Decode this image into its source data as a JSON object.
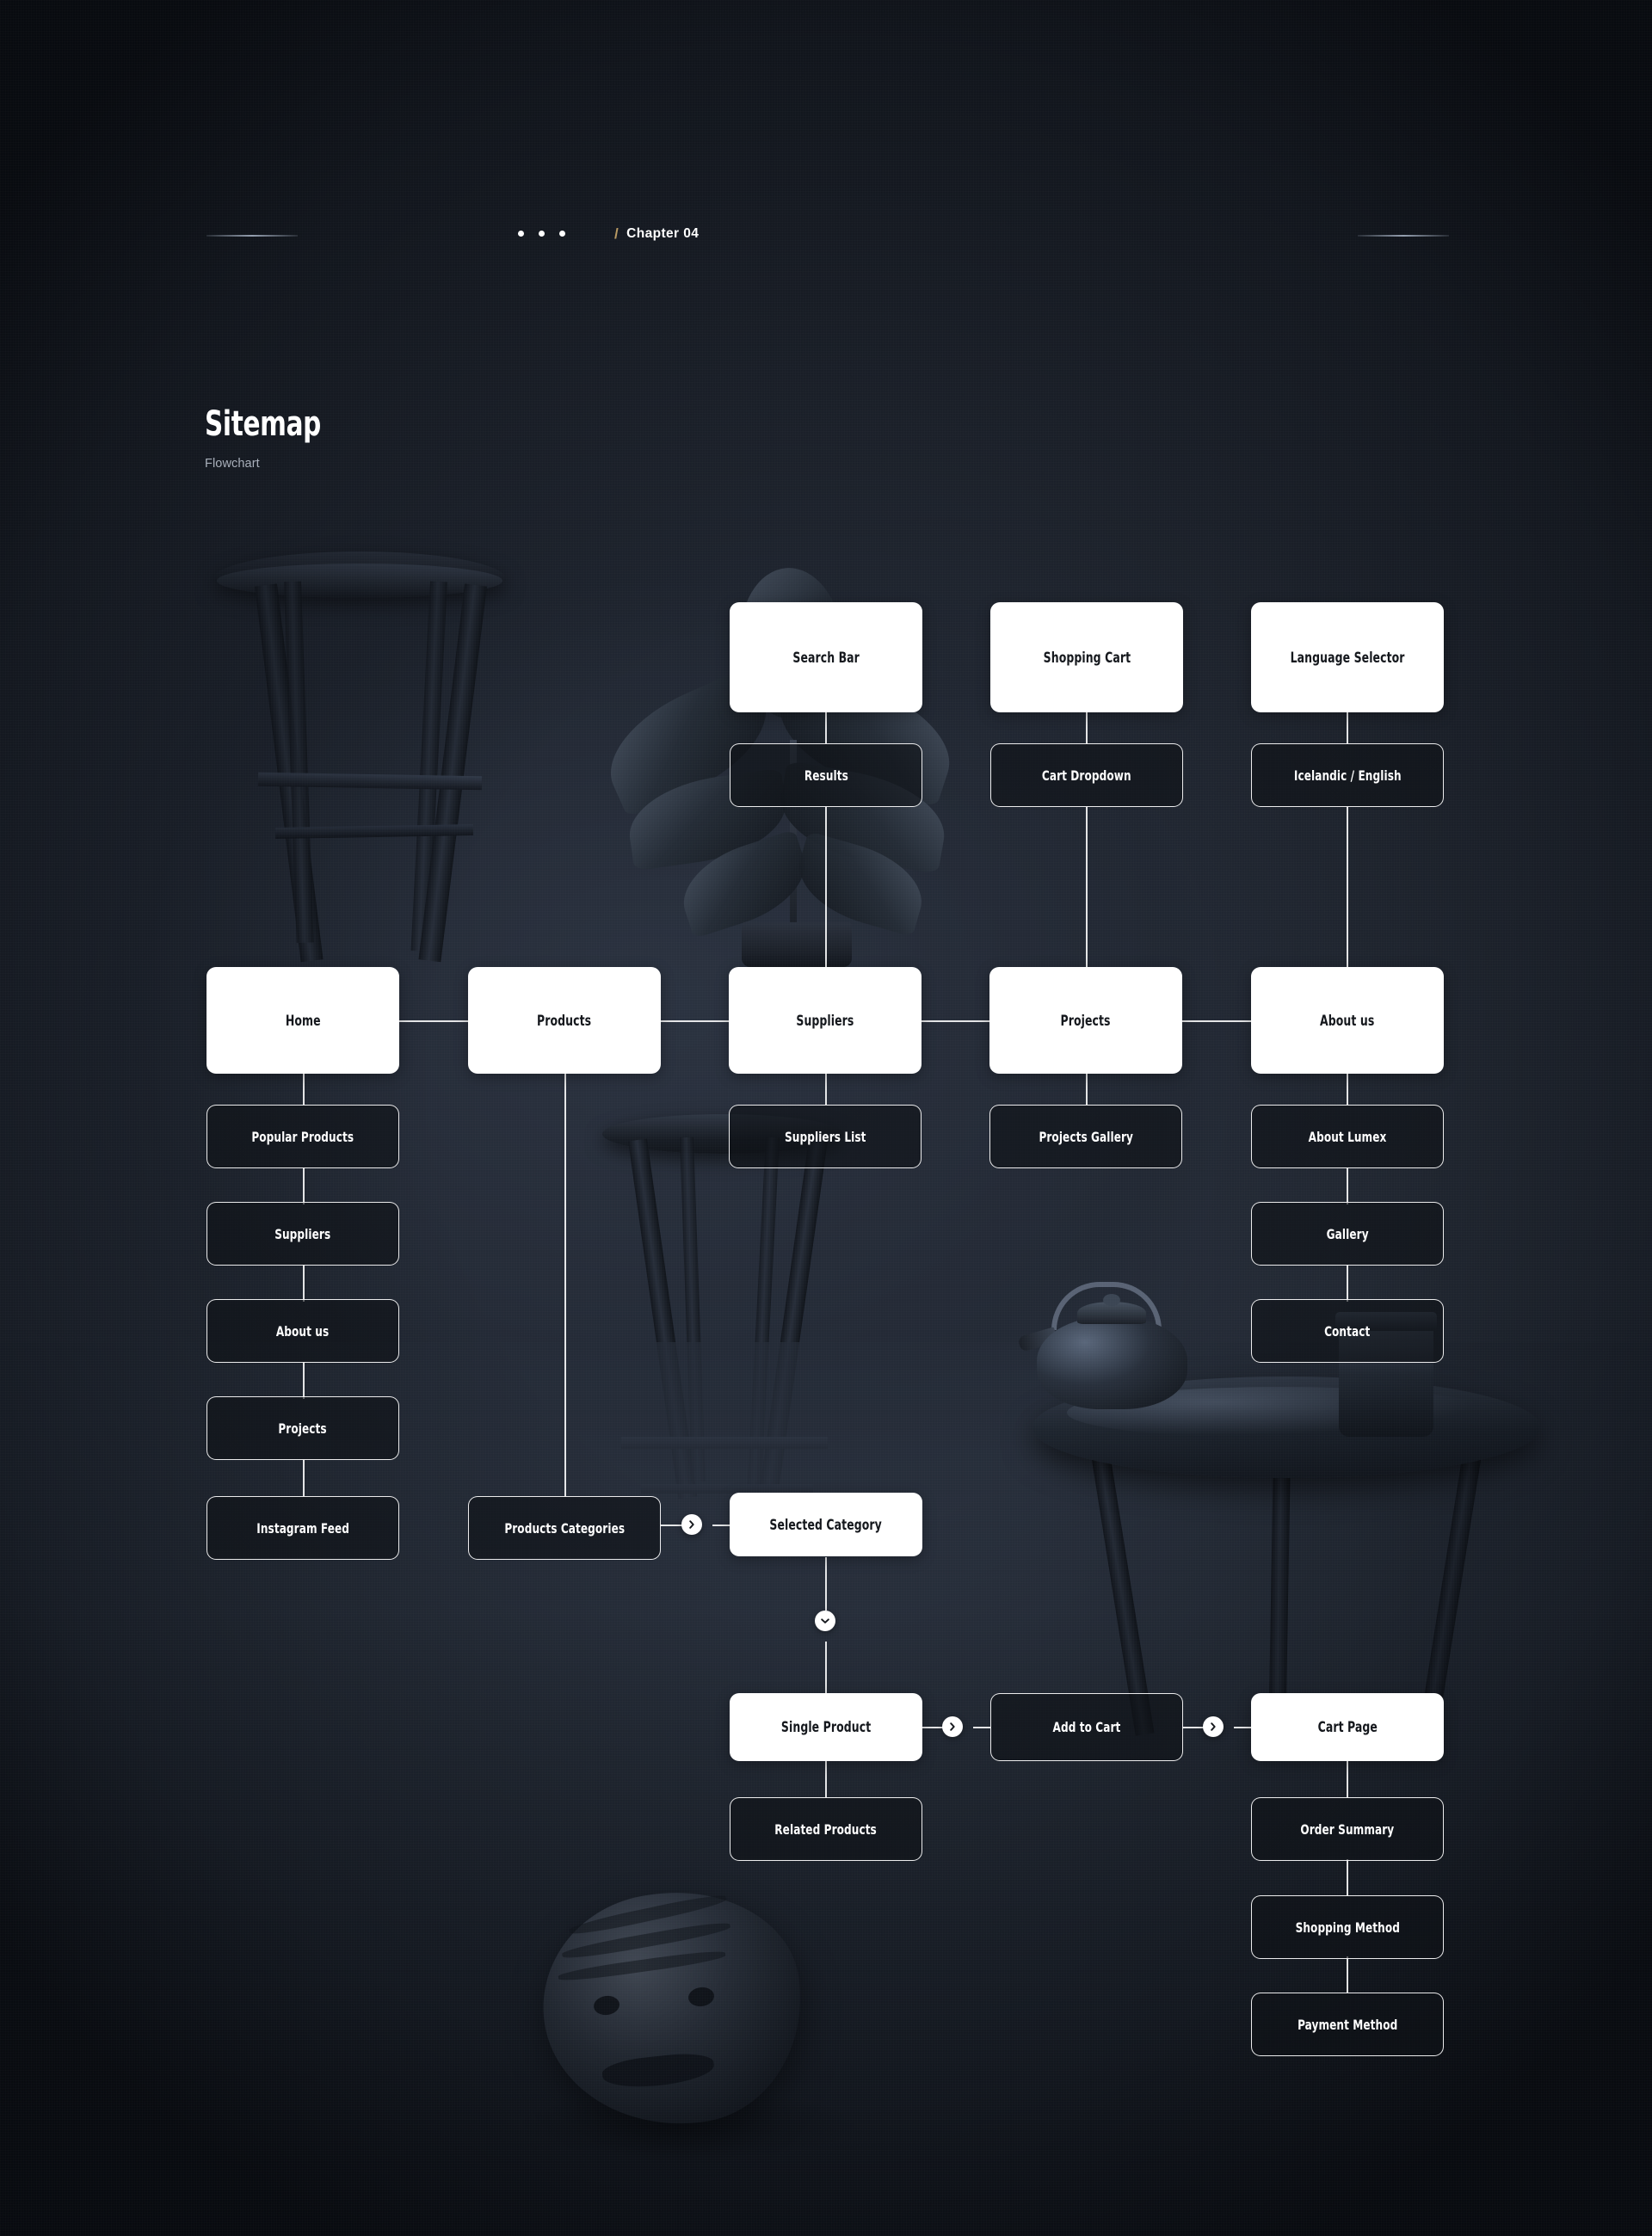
{
  "header": {
    "dots_count": 3,
    "slash": "/",
    "chapter_label": "Chapter 04",
    "accent_color": "#b99a63"
  },
  "page": {
    "title": "Sitemap",
    "subtitle": "Flowchart",
    "background_color": "#1a1f29",
    "card_color": "#ffffff",
    "card_text_color": "#15181d",
    "sub_card_border": "#ffffff"
  },
  "icons": {
    "arrow_right": "chevron-right-icon",
    "arrow_down": "chevron-down-icon"
  },
  "flowchart": {
    "type": "sitemap-flowchart",
    "top_utilities": [
      {
        "label": "Search Bar",
        "child": "Results"
      },
      {
        "label": "Shopping Cart",
        "child": "Cart Dropdown"
      },
      {
        "label": "Language Selector",
        "child": "Icelandic / English"
      }
    ],
    "main_nav": [
      {
        "label": "Home",
        "children": [
          "Popular Products",
          "Suppliers",
          "About us",
          "Projects",
          "Instagram Feed"
        ]
      },
      {
        "label": "Products",
        "children": [
          "Products Categories"
        ]
      },
      {
        "label": "Suppliers",
        "children": [
          "Suppliers List"
        ]
      },
      {
        "label": "Projects",
        "children": [
          "Projects Gallery"
        ]
      },
      {
        "label": "About us",
        "children": [
          "About Lumex",
          "Gallery",
          "Contact"
        ]
      }
    ],
    "shopping_flow": {
      "selected_category": "Selected Category",
      "single_product": "Single Product",
      "related_products": "Related Products",
      "add_to_cart": "Add to Cart",
      "cart_page": "Cart Page",
      "checkout_steps": [
        "Order Summary",
        "Shopping Method",
        "Payment Method"
      ]
    }
  }
}
